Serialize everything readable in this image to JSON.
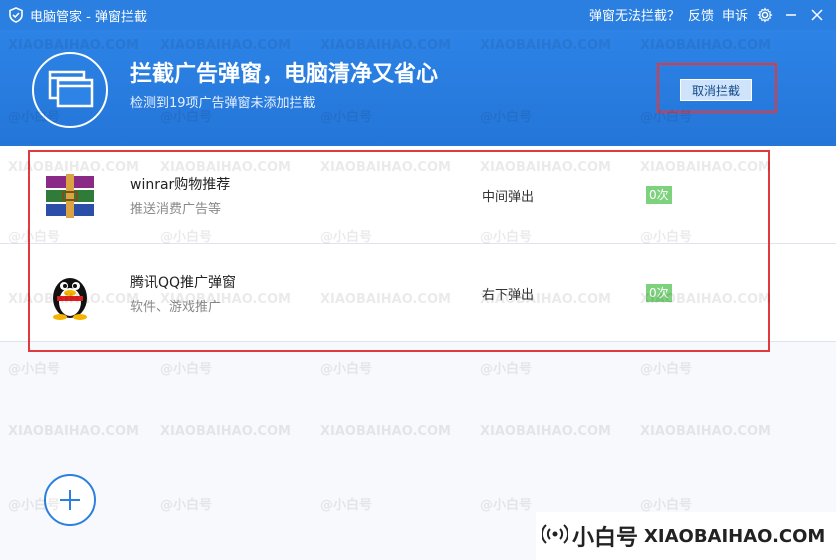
{
  "window": {
    "title": "电脑管家 - 弹窗拦截",
    "links": {
      "cannot_block": "弹窗无法拦截？",
      "feedback": "反馈",
      "complaint": "申诉"
    }
  },
  "header": {
    "headline": "拦截广告弹窗，电脑清净又省心",
    "subline": "检测到19项广告弹窗未添加拦截",
    "cancel_button": "取消拦截"
  },
  "rows": [
    {
      "name": "winrar购物推荐",
      "desc": "推送消费广告等",
      "mode": "中间弹出",
      "count": "0次",
      "icon": "winrar-books-icon"
    },
    {
      "name": "腾讯QQ推广弹窗",
      "desc": "软件、游戏推广",
      "mode": "右下弹出",
      "count": "0次",
      "icon": "qq-penguin-icon"
    }
  ],
  "watermark": {
    "site": "XIAOBAIHAO.COM",
    "handle": "@小白号",
    "banner_cn": "小白号",
    "banner_en": "XIAOBAIHAO.COM"
  },
  "colors": {
    "brand_blue": "#2a7fe0",
    "highlight_red": "#e0393e",
    "badge_green": "#7ed27e"
  }
}
